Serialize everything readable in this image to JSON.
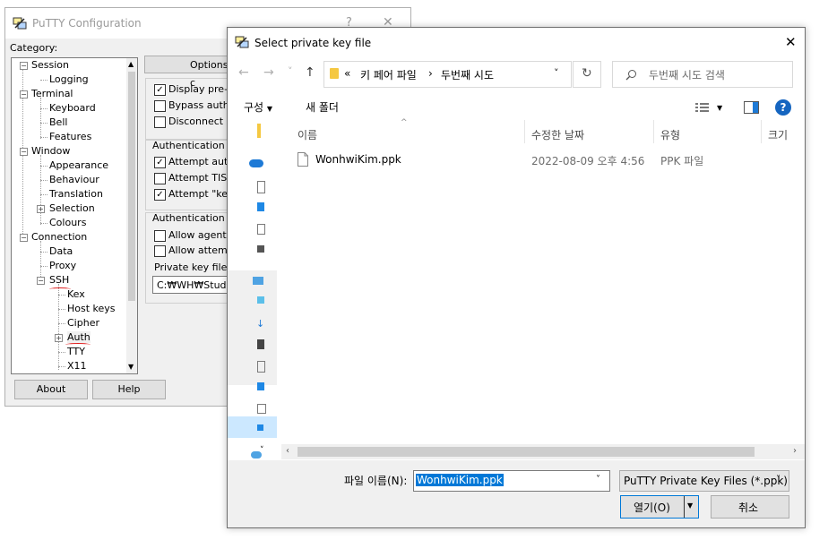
{
  "putty": {
    "title": "PuTTY Configuration",
    "help_glyph": "?",
    "close_glyph": "✕",
    "category_label": "Category:",
    "tree": [
      {
        "label": "Session"
      },
      {
        "label": "Logging"
      },
      {
        "label": "Terminal"
      },
      {
        "label": "Keyboard"
      },
      {
        "label": "Bell"
      },
      {
        "label": "Features"
      },
      {
        "label": "Window"
      },
      {
        "label": "Appearance"
      },
      {
        "label": "Behaviour"
      },
      {
        "label": "Translation"
      },
      {
        "label": "Selection"
      },
      {
        "label": "Colours"
      },
      {
        "label": "Connection"
      },
      {
        "label": "Data"
      },
      {
        "label": "Proxy"
      },
      {
        "label": "SSH"
      },
      {
        "label": "Kex"
      },
      {
        "label": "Host keys"
      },
      {
        "label": "Cipher"
      },
      {
        "label": "Auth"
      },
      {
        "label": "TTY"
      },
      {
        "label": "X11"
      }
    ],
    "options_button": "Options c",
    "options": {
      "display_preauth": "Display pre-au",
      "bypass_auth": "Bypass auther",
      "disconnect_if": "Disconnect if a",
      "auth_methods_group": "Authentication me",
      "attempt_auth": "Attempt auther",
      "attempt_tis": "Attempt TIS or",
      "attempt_keyb": "Attempt \"keyb",
      "auth_params_group": "Authentication pa",
      "allow_agent": "Allow agent fo",
      "allow_attempted": "Allow attempte",
      "private_key_label": "Private key file for",
      "private_key_value": "C:₩WH₩Study"
    },
    "about_button": "About",
    "help_button": "Help"
  },
  "dialog": {
    "title": "Select private key file",
    "close_glyph": "✕",
    "nav": {
      "back": "←",
      "forward": "→",
      "recent": "˅",
      "up": "↑"
    },
    "breadcrumb": {
      "overflow": "«",
      "crumb1": "키 페어 파일",
      "sep": "›",
      "crumb2": "두번째 시도",
      "dropdown": "˅"
    },
    "refresh_glyph": "↻",
    "search_placeholder": "두번째 시도 검색",
    "toolbar": {
      "organize": "구성",
      "new_folder": "새 폴더",
      "help": "?"
    },
    "columns": {
      "name": "이름",
      "date": "수정한 날짜",
      "type": "유형",
      "size": "크기"
    },
    "files": [
      {
        "name": "WonhwiKim.ppk",
        "date": "2022-08-09 오후 4:56",
        "type": "PPK 파일"
      }
    ],
    "filename_label": "파일 이름(N):",
    "filename_value": "WonhwiKim.ppk",
    "filetype_value": "PuTTY Private Key Files (*.ppk)",
    "open_button": "열기(O)",
    "cancel_button": "취소",
    "colors": {
      "selection": "#0078d7",
      "onedrive": "#1e7ad6",
      "help": "#1565c0"
    }
  }
}
